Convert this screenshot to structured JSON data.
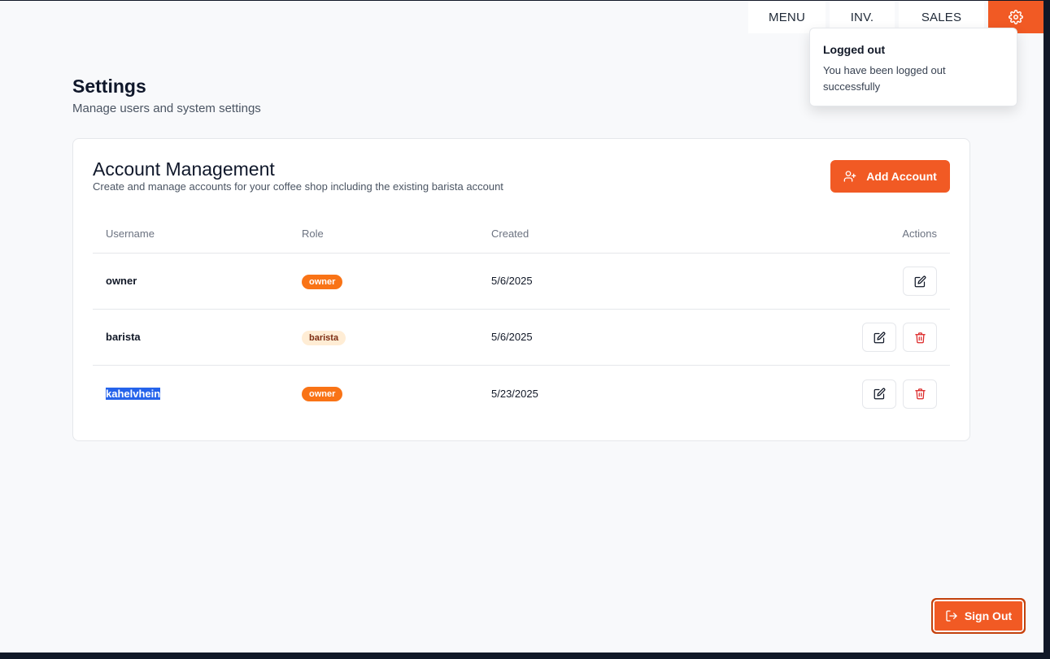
{
  "nav": {
    "tabs": [
      {
        "label": "MENU"
      },
      {
        "label": "INV."
      },
      {
        "label": "SALES"
      }
    ],
    "settings_icon": "gear-icon",
    "accent": "#f15a24"
  },
  "toast": {
    "title": "Logged out",
    "message": "You have been logged out successfully"
  },
  "page": {
    "title": "Settings",
    "subtitle": "Manage users and system settings"
  },
  "account_management": {
    "title": "Account Management",
    "description": "Create and manage accounts for your coffee shop including the existing barista account",
    "add_button": {
      "label": "Add Account",
      "icon": "user-plus-icon"
    },
    "columns": {
      "username": "Username",
      "role": "Role",
      "created": "Created",
      "actions": "Actions"
    },
    "rows": [
      {
        "username": "owner",
        "role": "owner",
        "created": "5/6/2025",
        "actions": [
          "edit"
        ]
      },
      {
        "username": "barista",
        "role": "barista",
        "created": "5/6/2025",
        "actions": [
          "edit",
          "delete"
        ]
      },
      {
        "username": "kahelvhein",
        "role": "owner",
        "created": "5/23/2025",
        "actions": [
          "edit",
          "delete"
        ],
        "selected": true
      }
    ]
  },
  "sign_out": {
    "label": "Sign Out",
    "icon": "log-out-icon"
  },
  "colors": {
    "brand": "#f15a24",
    "owner_badge": "#f97316",
    "barista_badge": "#ffedd5",
    "delete": "#dc2626"
  }
}
